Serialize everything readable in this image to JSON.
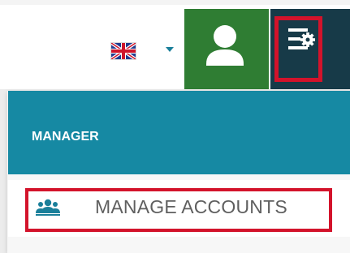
{
  "header": {
    "language": {
      "flag_icon": "uk-flag-icon",
      "caret_icon": "chevron-down-icon"
    },
    "user_button": {
      "icon": "user-icon"
    },
    "settings_button": {
      "icon": "settings-menu-icon",
      "highlighted": true
    }
  },
  "menu": {
    "section_title": "MANAGER",
    "items": [
      {
        "label": "MANAGE ACCOUNTS",
        "icon": "users-group-icon",
        "highlighted": true
      }
    ]
  },
  "colors": {
    "header_bg": "#ffffff",
    "user_button_bg": "#2f7d33",
    "settings_button_bg": "#173a48",
    "menu_header_bg": "#1689a3",
    "accent_teal": "#1a7f9a",
    "highlight_red": "#d3132b"
  }
}
